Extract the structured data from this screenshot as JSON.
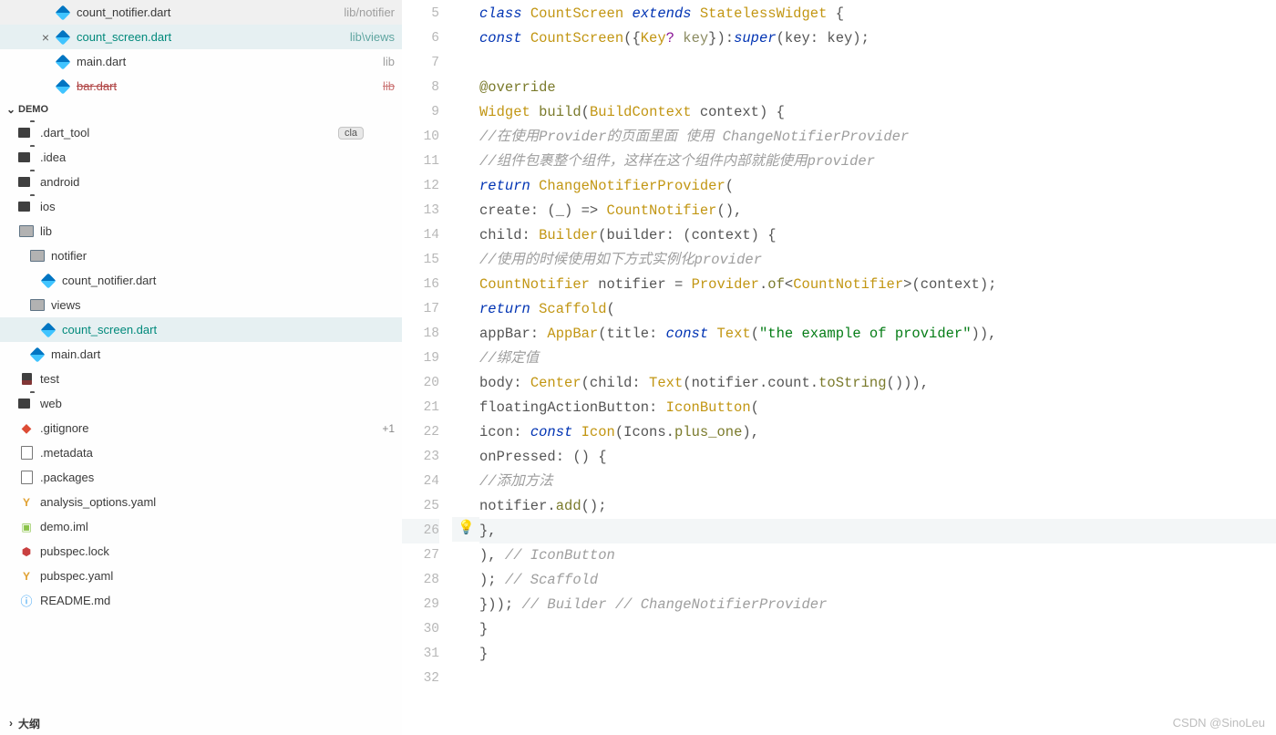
{
  "openEditors": [
    {
      "name": "count_notifier.dart",
      "path": "lib/notifier",
      "active": false,
      "strike": false,
      "teal": false
    },
    {
      "name": "count_screen.dart",
      "path": "lib\\views",
      "active": true,
      "strike": false,
      "teal": true
    },
    {
      "name": "main.dart",
      "path": "lib",
      "active": false,
      "strike": false,
      "teal": false
    },
    {
      "name": "bar.dart",
      "path": "lib",
      "active": false,
      "strike": true,
      "teal": false
    }
  ],
  "projectName": "DEMO",
  "badge": "cla",
  "tree": [
    {
      "label": ".dart_tool",
      "icon": "folder-dark",
      "indent": 1
    },
    {
      "label": ".idea",
      "icon": "folder-dark",
      "indent": 1
    },
    {
      "label": "android",
      "icon": "folder-dark",
      "indent": 1
    },
    {
      "label": "ios",
      "icon": "folder-dark",
      "indent": 1
    },
    {
      "label": "lib",
      "icon": "folder-blue",
      "indent": 1,
      "open": true
    },
    {
      "label": "notifier",
      "icon": "folder-blue",
      "indent": 2,
      "open": true
    },
    {
      "label": "count_notifier.dart",
      "icon": "dart-icon",
      "indent": 3
    },
    {
      "label": "views",
      "icon": "folder-blue",
      "indent": 2,
      "open": true
    },
    {
      "label": "count_screen.dart",
      "icon": "dart-icon",
      "indent": 3,
      "active": true,
      "teal": true
    },
    {
      "label": "main.dart",
      "icon": "dart-icon",
      "indent": 2
    },
    {
      "label": "test",
      "icon": "test-icon",
      "indent": 1
    },
    {
      "label": "web",
      "icon": "folder-dark",
      "indent": 1
    },
    {
      "label": ".gitignore",
      "icon": "git-icon",
      "indent": 1,
      "plus": "+1"
    },
    {
      "label": ".metadata",
      "icon": "file-generic",
      "indent": 1
    },
    {
      "label": ".packages",
      "icon": "file-generic",
      "indent": 1
    },
    {
      "label": "analysis_options.yaml",
      "icon": "yaml-icon",
      "indent": 1
    },
    {
      "label": "demo.iml",
      "icon": "iml-icon",
      "indent": 1
    },
    {
      "label": "pubspec.lock",
      "icon": "lock-icon",
      "indent": 1
    },
    {
      "label": "pubspec.yaml",
      "icon": "yaml-icon",
      "indent": 1
    },
    {
      "label": "README.md",
      "icon": "info-icon",
      "indent": 1
    }
  ],
  "outlineLabel": "大纲",
  "lineStart": 5,
  "lineEnd": 32,
  "highlightLine": 26,
  "bulbLine": 26,
  "code": {
    "l5": {
      "a": "class ",
      "b": "CountScreen ",
      "c": "extends ",
      "d": "StatelessWidget ",
      "e": "{"
    },
    "l6": {
      "a": "const ",
      "b": "CountScreen",
      "c": "({",
      "d": "Key",
      "e": "? ",
      "f": "key",
      "g": "}):",
      "h": "super",
      "i": "(key: key);"
    },
    "l8": {
      "a": "@override"
    },
    "l9": {
      "a": "Widget ",
      "b": "build",
      "c": "(",
      "d": "BuildContext ",
      "e": "context) {"
    },
    "l10": {
      "a": "//在使用Provider的页面里面 使用 ChangeNotifierProvider"
    },
    "l11": {
      "a": "//组件包裹整个组件，这样在这个组件内部就能使用provider"
    },
    "l12": {
      "a": "return ",
      "b": "ChangeNotifierProvider",
      "c": "("
    },
    "l13": {
      "a": "create: (_) => ",
      "b": "CountNotifier",
      "c": "(),"
    },
    "l14": {
      "a": "child: ",
      "b": "Builder",
      "c": "(builder: (context) {"
    },
    "l15": {
      "a": "//使用的时候使用如下方式实例化provider"
    },
    "l16": {
      "a": "CountNotifier ",
      "b": "notifier = ",
      "c": "Provider",
      "d": ".",
      "e": "of",
      "f": "<",
      "g": "CountNotifier",
      "h": ">(context);"
    },
    "l17": {
      "a": "return ",
      "b": "Scaffold",
      "c": "("
    },
    "l18": {
      "a": "appBar: ",
      "b": "AppBar",
      "c": "(title: ",
      "d": "const ",
      "e": "Text",
      "f": "(",
      "g": "\"the example of provider\"",
      "h": ")),"
    },
    "l19": {
      "a": "//绑定值"
    },
    "l20": {
      "a": "body: ",
      "b": "Center",
      "c": "(child: ",
      "d": "Text",
      "e": "(notifier.count.",
      "f": "toString",
      "g": "())),"
    },
    "l21": {
      "a": "floatingActionButton: ",
      "b": "IconButton",
      "c": "("
    },
    "l22": {
      "a": "icon: ",
      "b": "const ",
      "c": "Icon",
      "d": "(Icons.",
      "e": "plus_one",
      "f": "),"
    },
    "l23": {
      "a": "onPressed: () {"
    },
    "l24": {
      "a": "//添加方法"
    },
    "l25": {
      "a": "notifier.",
      "b": "add",
      "c": "();"
    },
    "l26": {
      "a": "},"
    },
    "l27": {
      "a": "), ",
      "b": "// IconButton"
    },
    "l28": {
      "a": "); ",
      "b": "// Scaffold"
    },
    "l29": {
      "a": "})); ",
      "b": "// Builder // ChangeNotifierProvider"
    },
    "l30": {
      "a": "}"
    },
    "l31": {
      "a": "}"
    }
  },
  "watermark": "CSDN @SinoLeu"
}
